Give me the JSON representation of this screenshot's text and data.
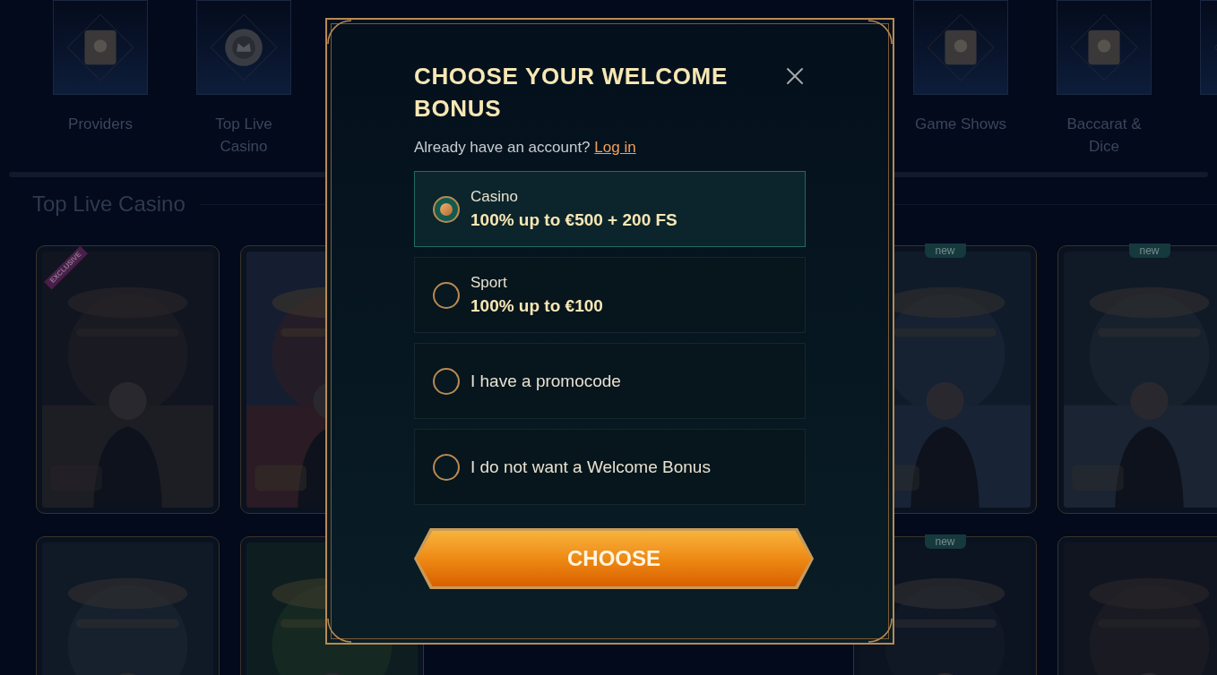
{
  "categories": [
    {
      "label": "Providers"
    },
    {
      "label": "Top Live Casino"
    },
    {
      "label": "Game Shows"
    },
    {
      "label": "Baccarat & Dice"
    }
  ],
  "section_title": "Top Live Casino",
  "game_rows": [
    [
      {
        "kind": "picture",
        "ribbon": "EXCLUSIVE"
      },
      {
        "kind": "picture"
      },
      {
        "kind": "picture",
        "badge": "new"
      },
      {
        "kind": "picture",
        "badge": "new"
      }
    ],
    [
      {
        "kind": "picture"
      },
      {
        "kind": "picture"
      },
      {
        "kind": "picture",
        "badge": "new"
      },
      {
        "kind": "picture"
      }
    ]
  ],
  "modal": {
    "title": "CHOOSE YOUR WELCOME BONUS",
    "account_prompt": "Already have an account?",
    "login_link": "Log in",
    "options": [
      {
        "label": "Casino",
        "offer": "100% up to €500 + 200 FS",
        "selected": true
      },
      {
        "label": "Sport",
        "offer": "100% up to €100",
        "selected": false
      },
      {
        "offer": "I have a promocode",
        "selected": false
      },
      {
        "offer": "I do not want a Welcome Bonus",
        "selected": false
      }
    ],
    "button": "CHOOSE"
  }
}
